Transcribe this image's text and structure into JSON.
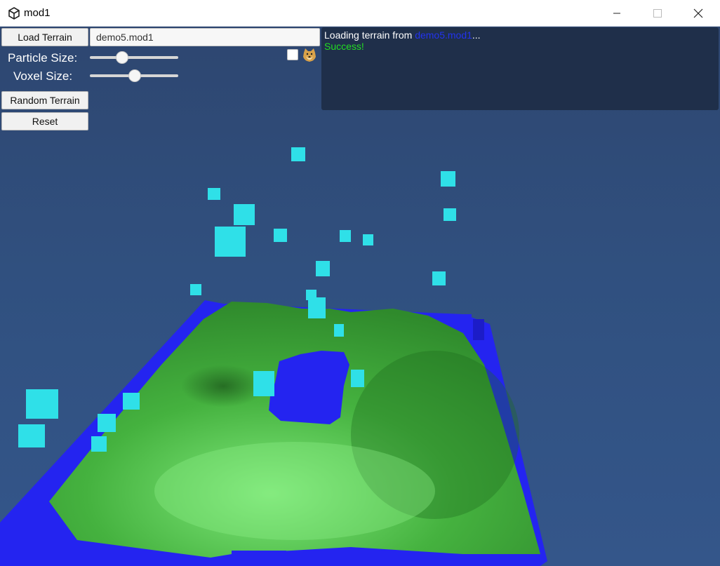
{
  "window": {
    "title": "mod1"
  },
  "controls": {
    "load_button": "Load Terrain",
    "file_field": "demo5.mod1",
    "particle_label": "Particle Size:",
    "particle_value": 0.36,
    "voxel_label": "Voxel Size:",
    "voxel_value": 0.5,
    "random_button": "Random Terrain",
    "reset_button": "Reset",
    "checkbox_checked": false
  },
  "log": {
    "line1_prefix": "Loading terrain from ",
    "line1_file": "demo5.mod1",
    "line1_suffix": "...",
    "line2": "Success!"
  },
  "colors": {
    "water": "#2222ee",
    "particle": "#2fe0e8",
    "terrain": "#3da83a",
    "success": "#22dd22",
    "log_file": "#2233ee"
  }
}
